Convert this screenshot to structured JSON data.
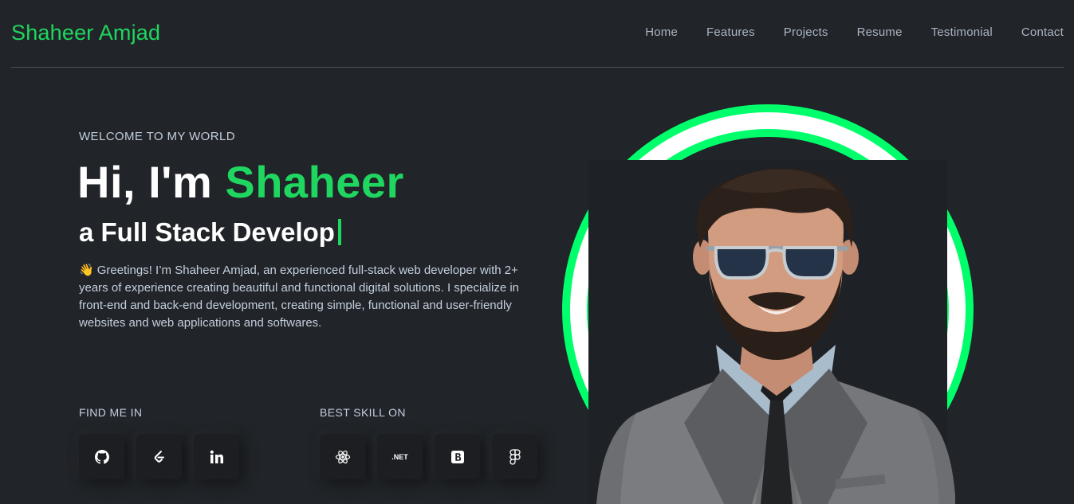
{
  "header": {
    "brand": "Shaheer Amjad",
    "nav": [
      "Home",
      "Features",
      "Projects",
      "Resume",
      "Testimonial",
      "Contact"
    ]
  },
  "hero": {
    "welcome": "WELCOME TO MY WORLD",
    "greeting": "Hi, I'm",
    "name": "Shaheer",
    "typed_role": "a Full Stack Develop",
    "intro_emoji": "👋",
    "intro": "Greetings! I’m Shaheer Amjad, an experienced full-stack web developer with 2+ years of experience creating beautiful and functional digital solutions. I specialize in front-end and back-end development, creating simple, functional and user-friendly websites and web applications and softwares."
  },
  "find_me": {
    "label": "FIND ME IN",
    "icons": [
      "github-icon",
      "leetcode-icon",
      "linkedin-icon"
    ]
  },
  "skills": {
    "label": "BEST SKILL ON",
    "icons": [
      "react-icon",
      "dotnet-icon",
      "bootstrap-icon",
      "figma-icon"
    ],
    "dotnet_text": ".NET"
  },
  "colors": {
    "accent": "#1fd760",
    "ring": "#00ff6a",
    "background": "#212428"
  }
}
